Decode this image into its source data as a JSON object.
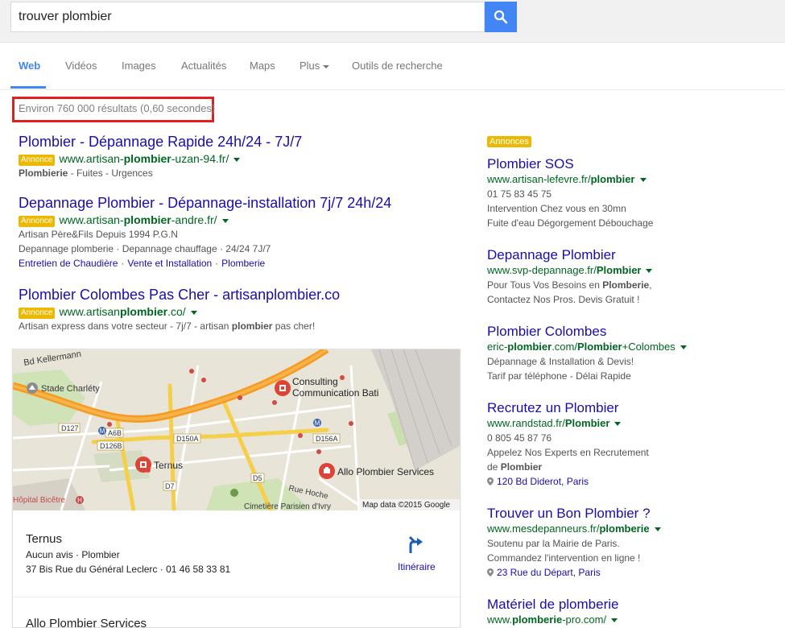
{
  "search": {
    "query": "trouver plombier"
  },
  "tabs": [
    "Web",
    "Vidéos",
    "Images",
    "Actualités",
    "Maps",
    "Plus",
    "Outils de recherche"
  ],
  "stats": "Environ 760 000 résultats (0,60 secondes)",
  "ad_badge": "Annonce",
  "left_ads": [
    {
      "title": "Plombier - Dépannage Rapide 24h/24 - 7J/7",
      "url_pre": "www.artisan-",
      "url_bold": "plombier",
      "url_post": "-uzan-94.fr/",
      "desc_bold": "Plombierie",
      "desc_rest": " - Fuites - Urgences"
    },
    {
      "title": "Depannage Plombier - Dépannage-installation 7j/7 24h/24",
      "url_pre": "www.artisan-",
      "url_bold": "plombier",
      "url_post": "-andre.fr/",
      "desc1": "Artisan Père&Fils Depuis 1994 P.G.N",
      "desc2": "Depannage plomberie · Depannage chauffage · 24/24 7J/7",
      "sitelinks": [
        "Entretien de Chaudière",
        "Vente et Installation",
        "Plomberie"
      ]
    },
    {
      "title": "Plombier Colombes Pas Cher - artisanplombier.co",
      "url_pre": "www.artisan",
      "url_bold": "plombier",
      "url_post": ".co/",
      "desc_pre": "Artisan express dans votre secteur - 7j/7 - artisan ",
      "desc_bold": "plombier",
      "desc_post": " pas cher!"
    }
  ],
  "map": {
    "labels": {
      "bd_kellermann": "Bd Kellermann",
      "stade": "Stade Charléty",
      "consulting": "Consulting",
      "consulting2": "Communication Bati",
      "ternus": "Ternus",
      "allo": "Allo Plombier Services",
      "hopital": "Hôpital Bicêtre",
      "cimetiere": "Cimetière Parisien d'Ivry",
      "rue_hoche": "Rue Hoche",
      "d127": "D127",
      "a6b": "A6B",
      "d126b": "D126B",
      "d150a": "D150A",
      "d156a": "D156A",
      "d5": "D5",
      "d7": "D7",
      "h": "H",
      "m": "M"
    },
    "attribution": "Map data ©2015 Google"
  },
  "places": [
    {
      "name": "Ternus",
      "rating": "Aucun avis · Plombier",
      "address": "37 Bis Rue du Général Leclerc · 01 46 58 33 81"
    },
    {
      "name": "Allo Plombier Services"
    }
  ],
  "directions_label": "Itinéraire",
  "right_badge": "Annonces",
  "right_ads": [
    {
      "title": "Plombier SOS",
      "url_pre": "www.artisan-lefevre.fr/",
      "url_bold": "plombier",
      "url_post": "",
      "lines": [
        "01 75 83 45 75",
        "Intervention Chez vous en 30mn",
        "Fuite d'eau Dégorgement Débouchage"
      ]
    },
    {
      "title": "Depannage Plombier",
      "url_pre": "www.svp-depannage.fr/",
      "url_bold": "Plombier",
      "url_post": "",
      "line1_pre": "Pour Tous Vos Besoins en ",
      "line1_bold": "Plomberie",
      "line1_post": ",",
      "line2": "Contactez Nos Pros. Devis Gratuit !"
    },
    {
      "title": "Plombier Colombes",
      "url_pre": "eric-",
      "url_bold": "plombier",
      "url_mid": ".com/",
      "url_bold2": "Plombier",
      "url_post": "+Colombes",
      "lines": [
        "Dépannage & Installation & Devis!",
        "Tarif par téléphone - Délai Rapide"
      ]
    },
    {
      "title": "Recrutez un Plombier",
      "url_pre": "www.randstad.fr/",
      "url_bold": "Plombier",
      "url_post": "",
      "line1": "0 805 45 87 76",
      "line2": "Appelez Nos Experts en Recrutement",
      "line3_pre": "de ",
      "line3_bold": "Plombier",
      "address": "120 Bd Diderot, Paris"
    },
    {
      "title": "Trouver un Bon Plombier ?",
      "url_pre": "www.mesdepanneurs.fr/",
      "url_bold": "plomberie",
      "url_post": "",
      "lines": [
        "Soutenu par la Mairie de Paris.",
        "Commandez l'intervention en ligne !"
      ],
      "address": "23 Rue du Départ, Paris"
    },
    {
      "title": "Matériel de plomberie",
      "url_pre": "www.",
      "url_bold": "plomberie",
      "url_post": "-pro.com/"
    }
  ],
  "colors": {
    "link": "#1a0dab",
    "url": "#006621",
    "ad_badge": "#edb802",
    "highlight_box": "#e0201f",
    "search_button": "#4285f4"
  }
}
